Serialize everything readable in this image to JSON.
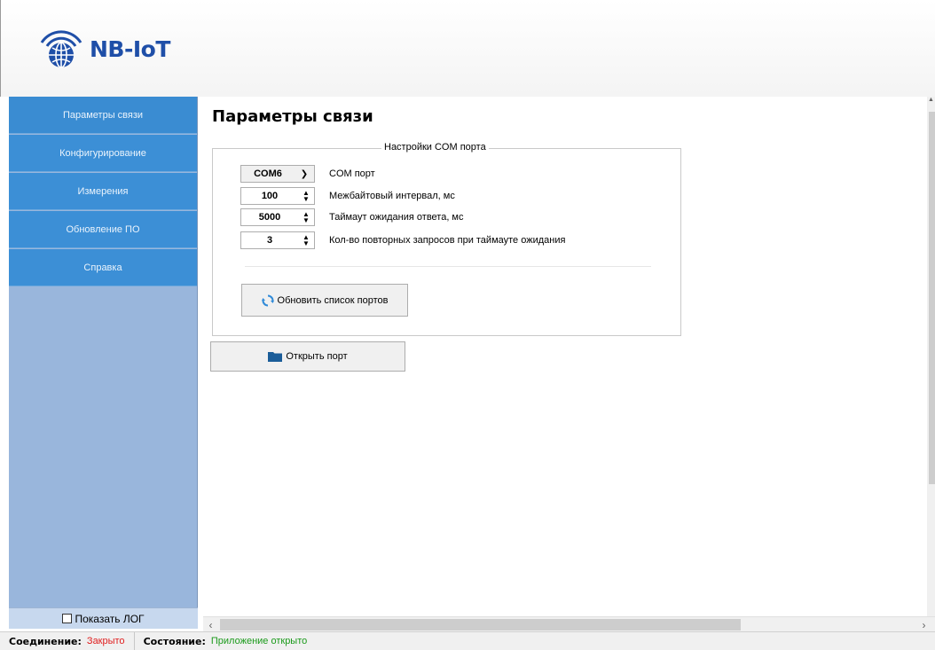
{
  "header": {
    "logo_text": "NB-IoT"
  },
  "sidebar": {
    "items": [
      {
        "label": "Параметры связи"
      },
      {
        "label": "Конфигурирование"
      },
      {
        "label": "Измерения"
      },
      {
        "label": "Обновление ПО"
      },
      {
        "label": "Справка"
      }
    ],
    "show_log_label": "Показать ЛОГ",
    "show_log_checked": false
  },
  "main": {
    "title": "Параметры связи",
    "group_title": "Настройки COM порта",
    "com_port": {
      "value": "COM6",
      "label": "COM порт"
    },
    "interbyte": {
      "value": "100",
      "label": "Межбайтовый интервал, мс"
    },
    "timeout": {
      "value": "5000",
      "label": "Таймаут ожидания ответа, мс"
    },
    "retries": {
      "value": "3",
      "label": "Кол-во повторных запросов при таймауте ожидания"
    },
    "refresh_button": "Обновить список портов",
    "open_button": "Открыть порт"
  },
  "statusbar": {
    "connection_label": "Соединение:",
    "connection_value": "Закрыто",
    "state_label": "Состояние:",
    "state_value": "Приложение открыто"
  },
  "colors": {
    "sidebar_item": "#3c8fd6",
    "sidebar_bg": "#99b6dc",
    "status_closed": "#e02020",
    "status_ok": "#1a9a1a",
    "logo": "#1f4fa8"
  }
}
